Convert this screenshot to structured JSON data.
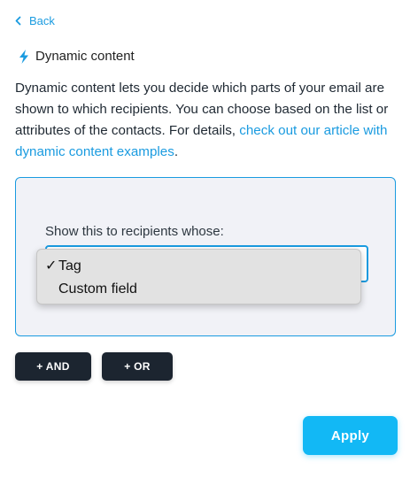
{
  "nav": {
    "back_label": "Back"
  },
  "header": {
    "title": "Dynamic content",
    "icon": "lightning-bolt-icon"
  },
  "description": {
    "text": "Dynamic content lets you decide which parts of your email are shown to which recipients. You can choose based on the list or attributes of the contacts. For details, ",
    "link_text": "check out our article with dynamic content examples",
    "suffix": "."
  },
  "condition": {
    "label": "Show this to recipients whose:",
    "dropdown": {
      "selected": "Tag",
      "options": [
        "Tag",
        "Custom field"
      ],
      "check_glyph": "✓"
    }
  },
  "logic_buttons": {
    "and_label": "+ AND",
    "or_label": "+ OR"
  },
  "footer": {
    "apply_label": "Apply"
  },
  "colors": {
    "accent": "#1a9be0",
    "apply_button": "#12b8f5",
    "dark_button": "#1c2530",
    "panel_background": "#f1f2f7"
  }
}
